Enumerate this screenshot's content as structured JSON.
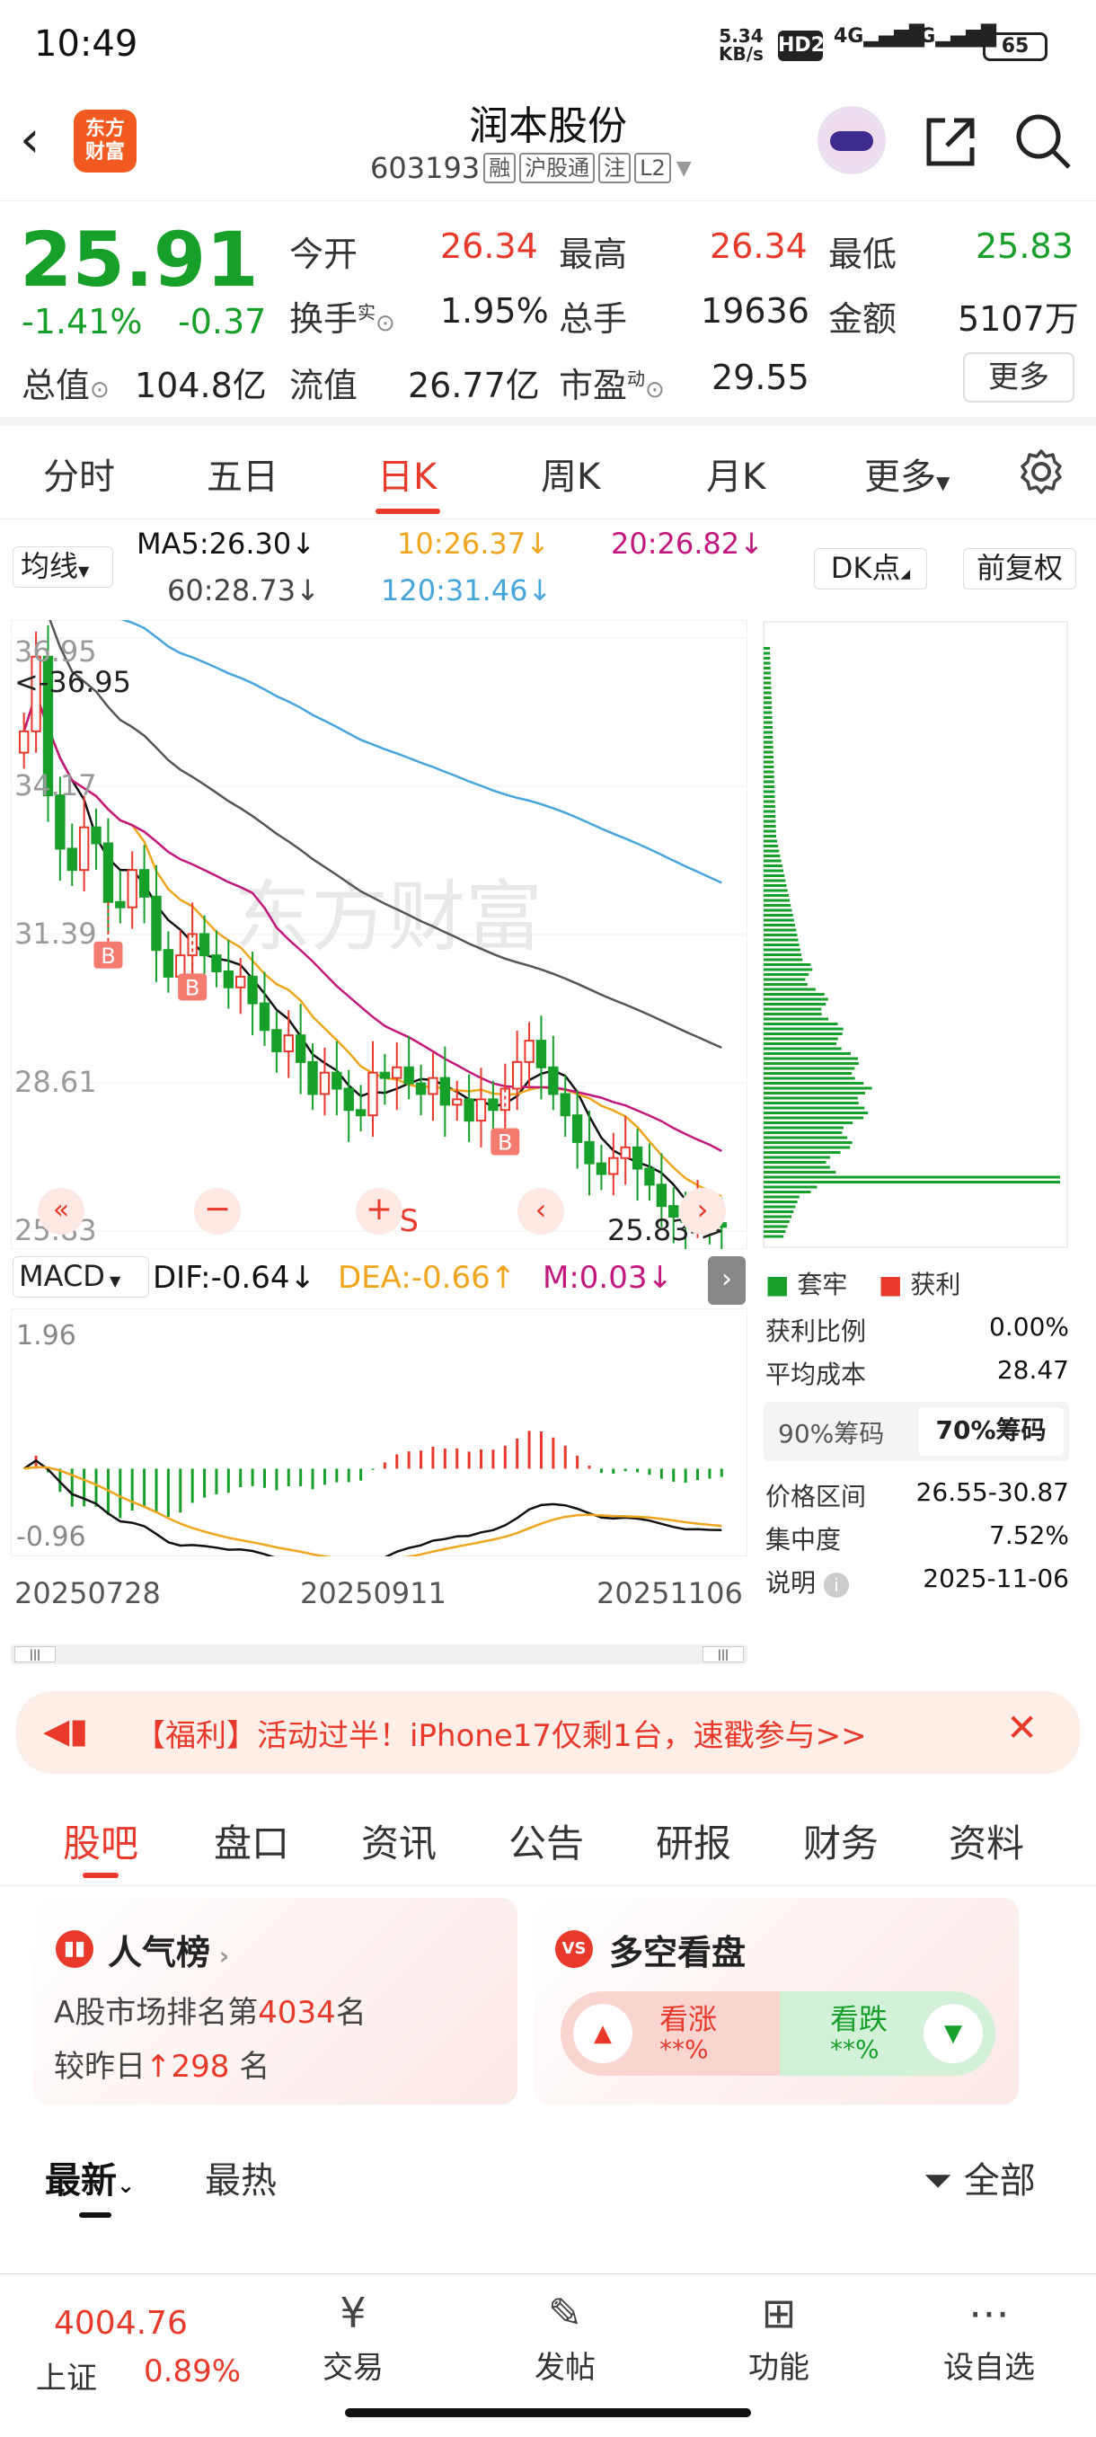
{
  "status": {
    "time": "10:49",
    "net_speed": "5.34",
    "net_unit": "KB/s",
    "hd": "HD2",
    "sig1": "4G",
    "sig2": "4G",
    "battery": "65"
  },
  "header": {
    "back_icon": "chevron-left-icon",
    "logo_text_1": "东方",
    "logo_text_2": "财富",
    "title": "润本股份",
    "code": "603193",
    "tags": [
      "融",
      "沪股通",
      "注",
      "L2"
    ]
  },
  "quote": {
    "price": "25.91",
    "change_pct": "-1.41%",
    "change": "-0.37",
    "open_label": "今开",
    "open": "26.34",
    "high_label": "最高",
    "high": "26.34",
    "low_label": "最低",
    "low": "25.83",
    "turnover_label": "换手",
    "turnover_sup": "实",
    "turnover": "1.95%",
    "volume_label": "总手",
    "volume": "19636",
    "amount_label": "金额",
    "amount": "5107万",
    "mcap_label": "总值",
    "mcap": "104.8亿",
    "float_label": "流值",
    "float": "26.77亿",
    "pe_label": "市盈",
    "pe_sup": "动",
    "pe": "29.55",
    "more": "更多"
  },
  "tabs": {
    "items": [
      "分时",
      "五日",
      "日K",
      "周K",
      "月K",
      "更多"
    ],
    "active": 2
  },
  "ma": {
    "selector": "均线",
    "ma5": "MA5:26.30",
    "ma10": "10:26.37",
    "ma20": "20:26.82",
    "ma60": "60:28.73",
    "ma120": "120:31.46",
    "dk": "DK点",
    "restore": "前复权"
  },
  "chart_data": {
    "type": "candlestick",
    "y_labels": [
      "36.95",
      "34.17",
      "31.39",
      "28.61",
      "25.83"
    ],
    "ylim": [
      25.83,
      36.95
    ],
    "max_label": "<-36.95",
    "min_label": "25.83->",
    "x_labels": [
      "20250728",
      "20250911",
      "20251106"
    ],
    "watermark": "东方财富",
    "signal_labels": [
      "B",
      "B",
      "B",
      "S"
    ],
    "macd": {
      "label": "MACD",
      "dif": "DIF:-0.64",
      "dea": "DEA:-0.66",
      "m": "M:0.03",
      "y_max": "1.96",
      "y_min": "-0.96"
    },
    "closes": [
      35.2,
      36.6,
      34.0,
      33.0,
      32.6,
      33.4,
      33.1,
      32.0,
      31.9,
      32.6,
      32.1,
      31.1,
      30.6,
      31.0,
      31.4,
      31.0,
      30.7,
      30.4,
      30.6,
      30.1,
      29.6,
      29.2,
      29.5,
      29.0,
      28.4,
      28.8,
      28.5,
      28.1,
      28.0,
      28.8,
      28.7,
      28.9,
      28.6,
      28.4,
      28.7,
      28.2,
      28.3,
      27.9,
      28.3,
      28.1,
      28.5,
      29.0,
      29.4,
      28.9,
      28.4,
      28.0,
      27.5,
      27.1,
      26.9,
      27.2,
      27.4,
      27.0,
      26.7,
      26.3,
      26.1,
      26.0,
      26.2,
      25.98,
      25.91
    ]
  },
  "chip_panel": {
    "legend_hold": "套牢",
    "legend_profit": "获利",
    "profit_ratio_label": "获利比例",
    "profit_ratio": "0.00%",
    "avg_cost_label": "平均成本",
    "avg_cost": "28.47",
    "tab90": "90%筹码",
    "tab70": "70%筹码",
    "range_label": "价格区间",
    "range": "26.55-30.87",
    "conc_label": "集中度",
    "conc": "7.52%",
    "note_label": "说明",
    "note": "2025-11-06"
  },
  "banner": {
    "text": "【福利】活动过半！iPhone17仅剩1台，速戳参与>>"
  },
  "bottom_tabs": {
    "items": [
      "股吧",
      "盘口",
      "资讯",
      "公告",
      "研报",
      "财务",
      "资料"
    ],
    "active": 0
  },
  "popularity": {
    "title": "人气榜",
    "rank_prefix": "A股市场排名第",
    "rank": "4034",
    "rank_suffix": "名",
    "change_prefix": "较昨日",
    "change": "298",
    "change_suffix": "名"
  },
  "sentiment": {
    "title": "多空看盘",
    "up_label": "看涨",
    "up_val": "**%",
    "down_label": "看跌",
    "down_val": "**%"
  },
  "feed": {
    "latest": "最新",
    "hot": "最热",
    "filter": "全部"
  },
  "index": {
    "value": "4004.76",
    "name": "上证",
    "pct": "0.89%"
  },
  "nav": {
    "trade": "交易",
    "post": "发帖",
    "func": "功能",
    "watch": "设自选"
  }
}
